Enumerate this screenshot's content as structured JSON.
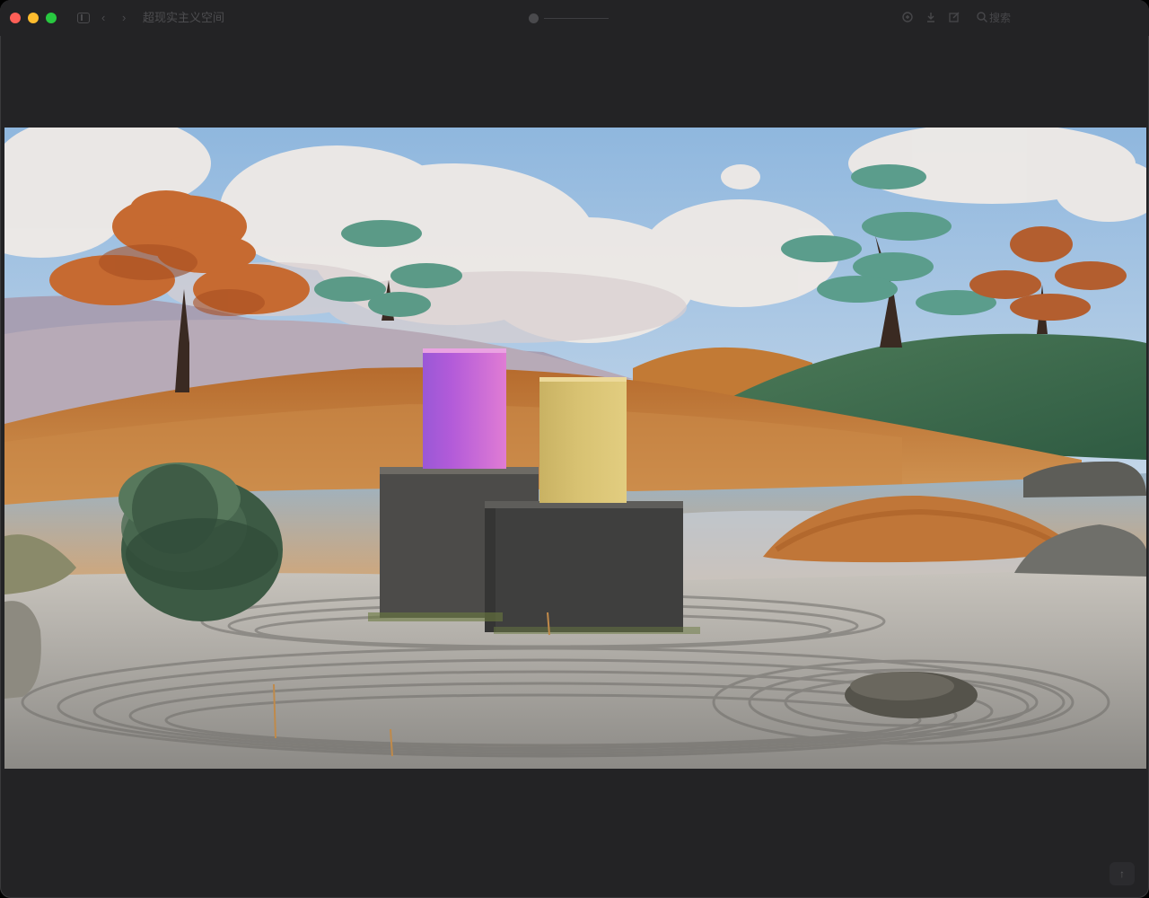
{
  "window": {
    "title": "超现实主义空间"
  },
  "toolbar": {
    "back_glyph": "‹",
    "forward_glyph": "›",
    "search_text": "搜索",
    "icons": [
      "sidebar-icon",
      "back-icon",
      "forward-icon",
      "record-icon",
      "share-icon",
      "download-icon",
      "edit-icon",
      "search-icon"
    ]
  },
  "image": {
    "alt_content": "surreal landscape render"
  },
  "scroll_top": {
    "glyph": "↑"
  }
}
